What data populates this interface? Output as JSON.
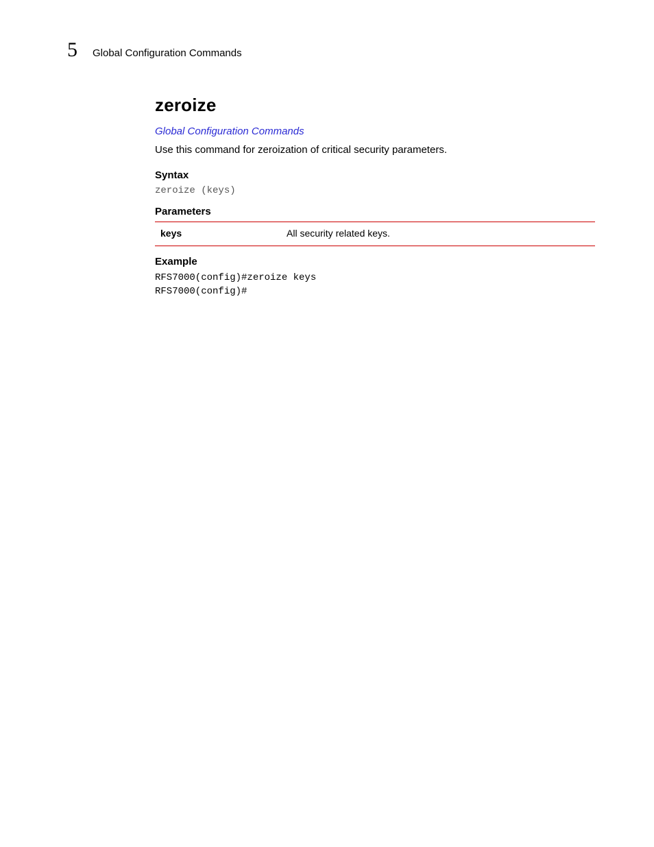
{
  "header": {
    "chapter_number": "5",
    "chapter_title": "Global Configuration Commands"
  },
  "command": {
    "name": "zeroize",
    "breadcrumb_link": "Global Configuration Commands",
    "description": "Use this command for zeroization of critical security parameters."
  },
  "syntax": {
    "heading": "Syntax",
    "code": "zeroize (keys)"
  },
  "parameters": {
    "heading": "Parameters",
    "rows": [
      {
        "name": "keys",
        "desc": "All security related keys."
      }
    ]
  },
  "example": {
    "heading": "Example",
    "code": "RFS7000(config)#zeroize keys\nRFS7000(config)#"
  }
}
